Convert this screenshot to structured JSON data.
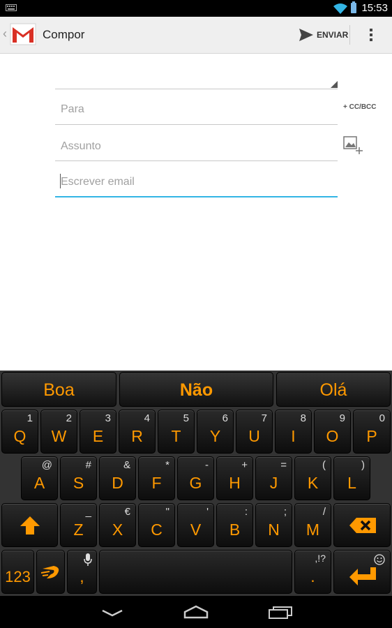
{
  "status_bar": {
    "time": "15:53"
  },
  "action_bar": {
    "title": "Compor",
    "send_label": "ENVIAR"
  },
  "compose": {
    "to_placeholder": "Para",
    "cc_bcc_label": "+ CC/BCC",
    "subject_placeholder": "Assunto",
    "body_placeholder": "Escrever email"
  },
  "keyboard": {
    "suggestions": [
      "Boa",
      "Não",
      "Olá"
    ],
    "row1": [
      {
        "main": "Q",
        "hint": "1"
      },
      {
        "main": "W",
        "hint": "2"
      },
      {
        "main": "E",
        "hint": "3"
      },
      {
        "main": "R",
        "hint": "4"
      },
      {
        "main": "T",
        "hint": "5"
      },
      {
        "main": "Y",
        "hint": "6"
      },
      {
        "main": "U",
        "hint": "7"
      },
      {
        "main": "I",
        "hint": "8"
      },
      {
        "main": "O",
        "hint": "9"
      },
      {
        "main": "P",
        "hint": "0"
      }
    ],
    "row2": [
      {
        "main": "A",
        "hint": "@"
      },
      {
        "main": "S",
        "hint": "#"
      },
      {
        "main": "D",
        "hint": "&"
      },
      {
        "main": "F",
        "hint": "*"
      },
      {
        "main": "G",
        "hint": "-"
      },
      {
        "main": "H",
        "hint": "+"
      },
      {
        "main": "J",
        "hint": "="
      },
      {
        "main": "K",
        "hint": "("
      },
      {
        "main": "L",
        "hint": ")"
      }
    ],
    "row3": [
      {
        "main": "Z",
        "hint": "_"
      },
      {
        "main": "X",
        "hint": "€"
      },
      {
        "main": "C",
        "hint": "\""
      },
      {
        "main": "V",
        "hint": "'"
      },
      {
        "main": "B",
        "hint": ":"
      },
      {
        "main": "N",
        "hint": ";"
      },
      {
        "main": "M",
        "hint": "/"
      }
    ],
    "numbers_label": "123",
    "comma_label": ",",
    "period_label": ".",
    "period_hint": ",!?"
  },
  "colors": {
    "accent": "#ff9900",
    "focus": "#33b5e5"
  }
}
